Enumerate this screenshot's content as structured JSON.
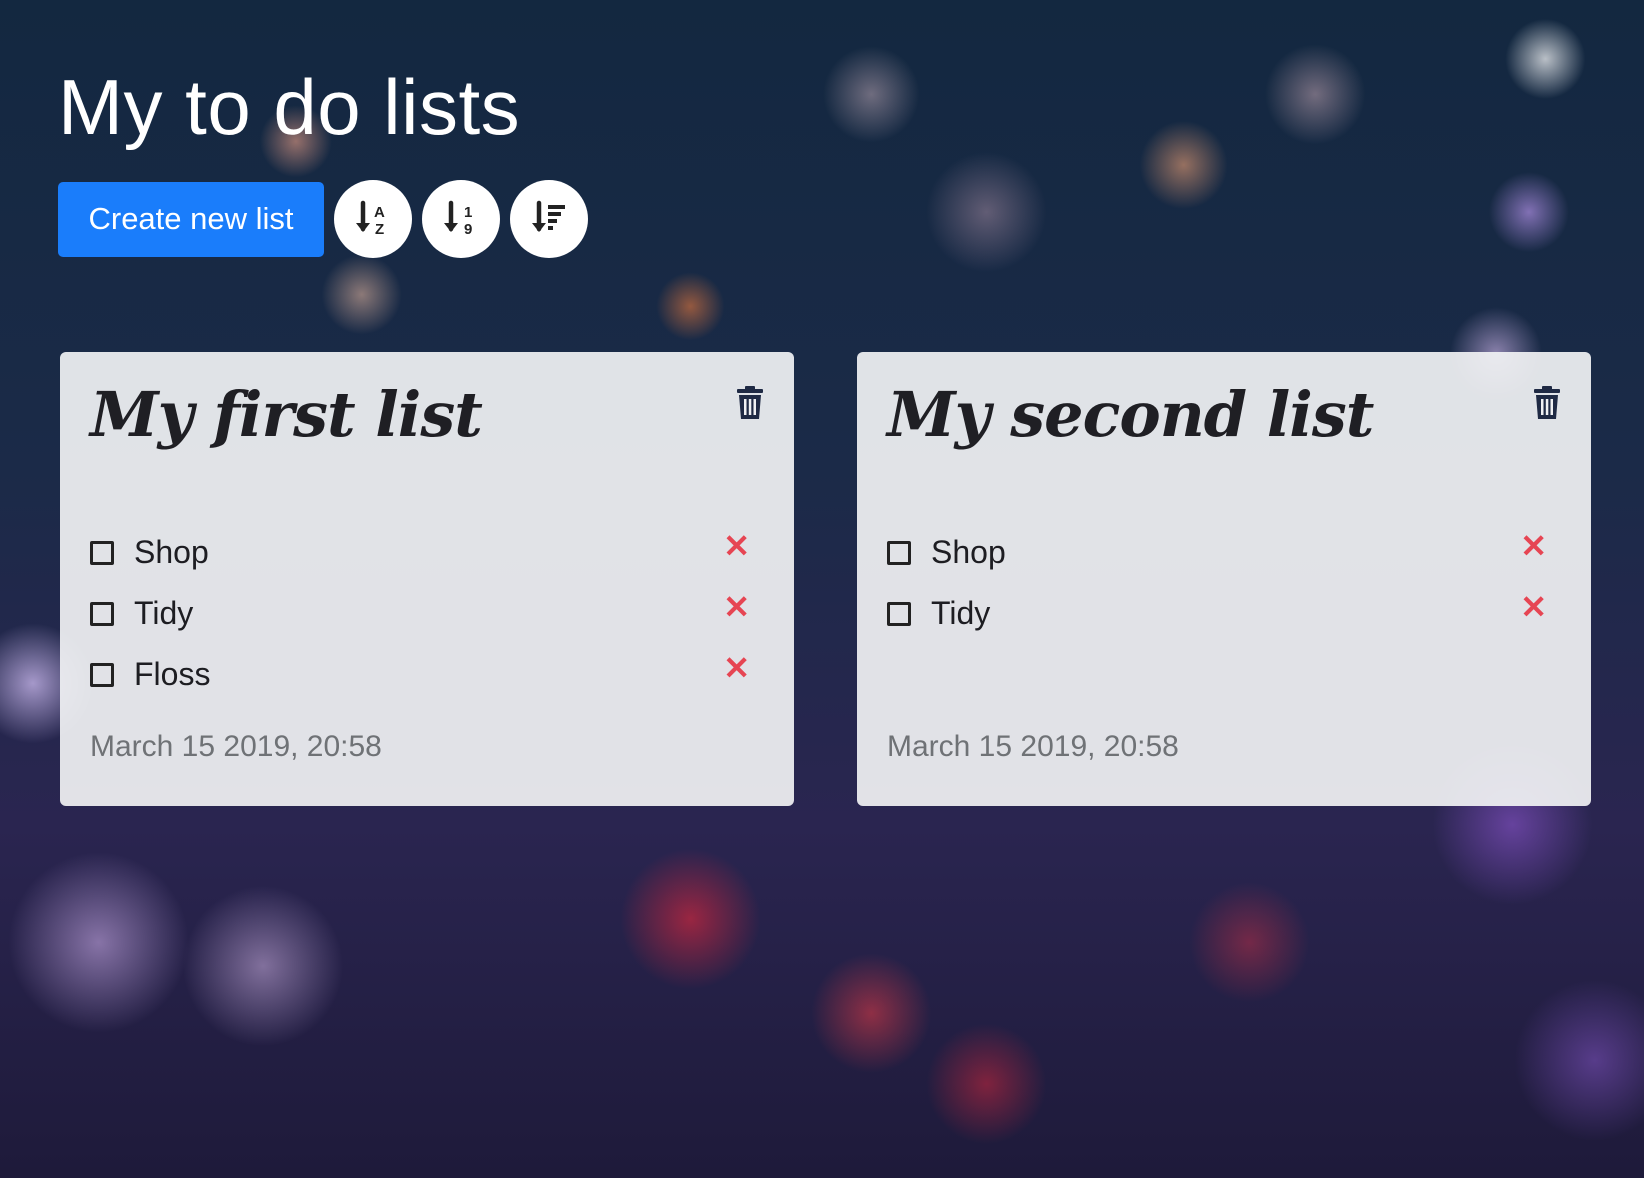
{
  "header": {
    "title": "My to do lists",
    "create_label": "Create new list",
    "sort_buttons": [
      {
        "icon": "sort-alpha-down-icon"
      },
      {
        "icon": "sort-numeric-down-icon"
      },
      {
        "icon": "sort-amount-down-icon"
      }
    ]
  },
  "lists": [
    {
      "title": "My first list",
      "items": [
        "Shop",
        "Tidy",
        "Floss"
      ],
      "timestamp": "March 15 2019, 20:58"
    },
    {
      "title": "My second list",
      "items": [
        "Shop",
        "Tidy"
      ],
      "timestamp": "March 15 2019, 20:58"
    }
  ],
  "colors": {
    "primary": "#1a7dfb",
    "remove": "#e64553",
    "card": "#f0f1f3"
  }
}
